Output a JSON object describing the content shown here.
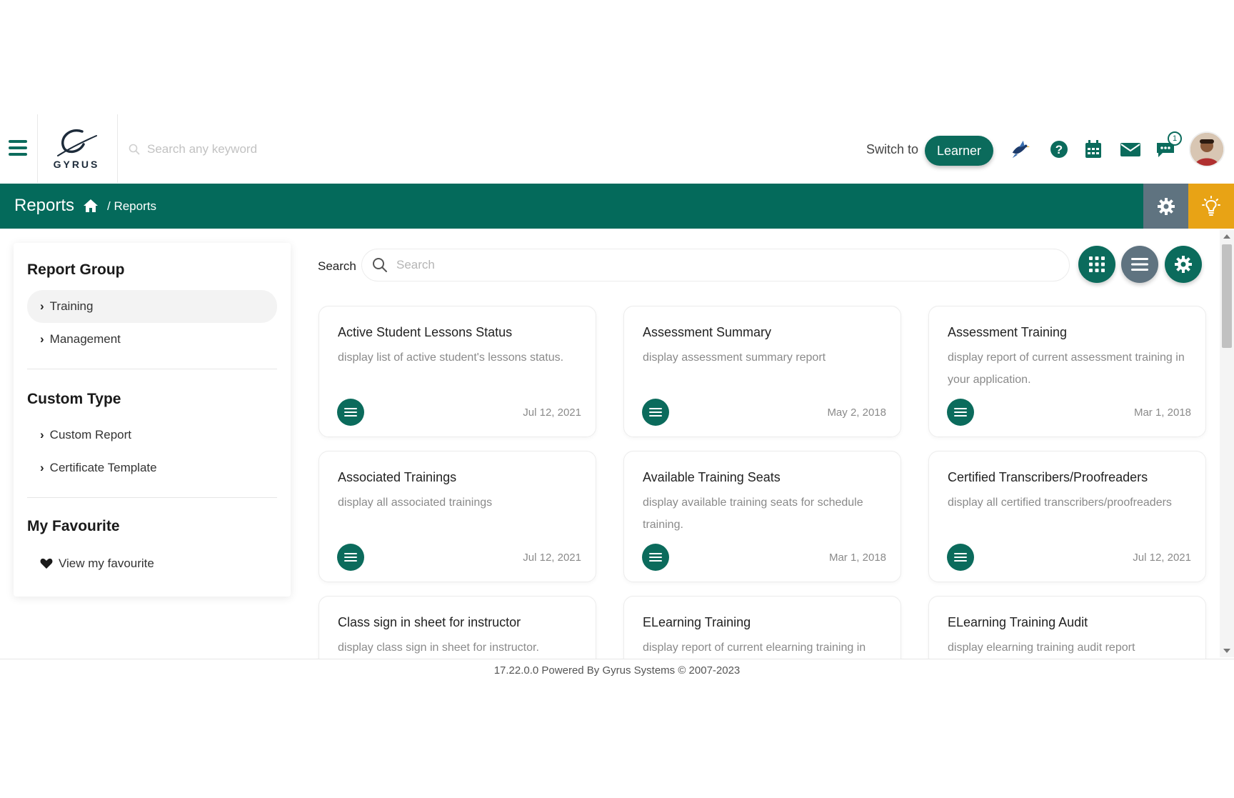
{
  "topbar": {
    "logo_text": "GYRUS",
    "search_placeholder": "Search any keyword",
    "switch_label": "Switch to",
    "learner_button": "Learner",
    "chat_badge": "1",
    "icons": [
      "menu-icon",
      "bird-icon",
      "help-icon",
      "calendar-icon",
      "mail-icon",
      "chat-icon",
      "avatar"
    ]
  },
  "header": {
    "title": "Reports",
    "breadcrumb": "/ Reports",
    "colors": {
      "bar": "#046a5b",
      "gear_bg": "#5f7380",
      "bulb_bg": "#e8a315"
    }
  },
  "sidebar": {
    "report_group": {
      "heading": "Report Group",
      "items": [
        {
          "label": "Training",
          "active": true
        },
        {
          "label": "Management",
          "active": false
        }
      ]
    },
    "custom_type": {
      "heading": "Custom Type",
      "items": [
        {
          "label": "Custom Report"
        },
        {
          "label": "Certificate Template"
        }
      ]
    },
    "favourite": {
      "heading": "My Favourite",
      "item": "View my favourite"
    }
  },
  "main": {
    "search_label": "Search",
    "search_placeholder": "Search",
    "cards": [
      {
        "title": "Active Student Lessons Status",
        "desc": "display list of active student's lessons status.",
        "date": "Jul 12, 2021"
      },
      {
        "title": "Assessment Summary",
        "desc": "display assessment summary report",
        "date": "May 2, 2018"
      },
      {
        "title": "Assessment Training",
        "desc": "display report of current assessment training in your application.",
        "date": "Mar 1, 2018"
      },
      {
        "title": "Associated Trainings",
        "desc": "display all associated trainings",
        "date": "Jul 12, 2021"
      },
      {
        "title": "Available Training Seats",
        "desc": "display available training seats for schedule training.",
        "date": "Mar 1, 2018"
      },
      {
        "title": "Certified Transcribers/Proofreaders",
        "desc": "display all certified transcribers/proofreaders",
        "date": "Jul 12, 2021"
      },
      {
        "title": "Class sign in sheet for instructor",
        "desc": "display class sign in sheet for instructor.",
        "date": ""
      },
      {
        "title": "ELearning Training",
        "desc": "display report of current elearning training in",
        "date": ""
      },
      {
        "title": "ELearning Training Audit",
        "desc": "display elearning training audit report",
        "date": ""
      }
    ],
    "accent": "#0b6b5c"
  },
  "footer": {
    "text": "17.22.0.0 Powered By Gyrus Systems © 2007-2023"
  }
}
